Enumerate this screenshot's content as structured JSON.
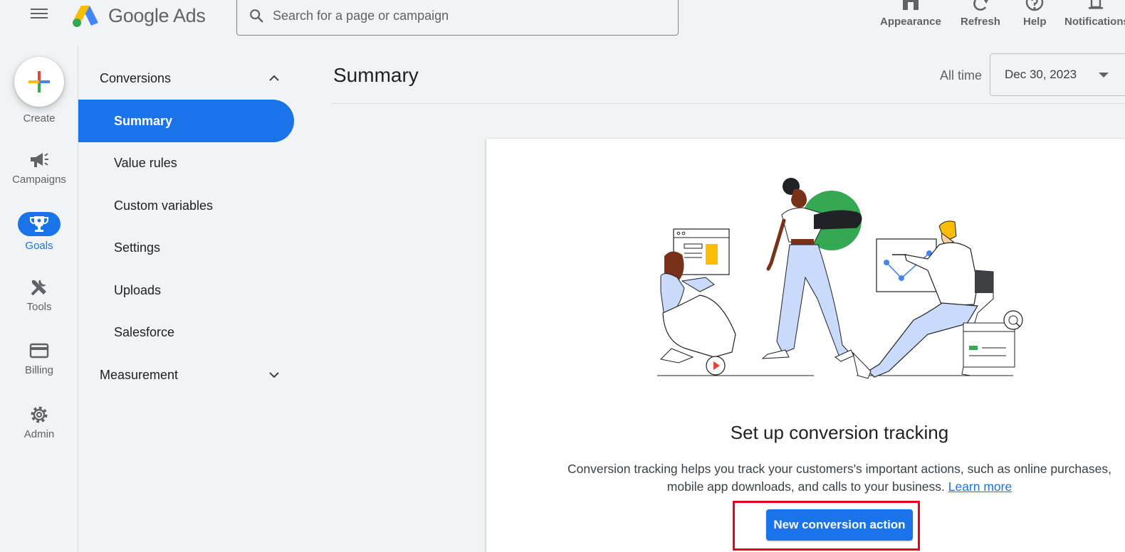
{
  "header": {
    "menu_icon": "hamburger-menu-icon",
    "logo_text": "Google Ads",
    "search_placeholder": "Search for a page or campaign",
    "actions": [
      {
        "label": "Appearance",
        "icon": "appearance-icon"
      },
      {
        "label": "Refresh",
        "icon": "refresh-icon"
      },
      {
        "label": "Help",
        "icon": "help-icon"
      },
      {
        "label": "Notifications",
        "icon": "bell-icon"
      }
    ]
  },
  "rail": {
    "create_label": "Create",
    "items": [
      {
        "label": "Campaigns",
        "icon": "megaphone-icon"
      },
      {
        "label": "Goals",
        "icon": "trophy-icon",
        "active": true
      },
      {
        "label": "Tools",
        "icon": "tools-icon"
      },
      {
        "label": "Billing",
        "icon": "credit-card-icon"
      },
      {
        "label": "Admin",
        "icon": "gear-icon"
      }
    ]
  },
  "nav": {
    "groups": [
      {
        "label": "Conversions",
        "expanded": true
      },
      {
        "label": "Measurement",
        "expanded": false
      }
    ],
    "items": [
      "Summary",
      "Value rules",
      "Custom variables",
      "Settings",
      "Uploads",
      "Salesforce"
    ],
    "active_item": "Summary"
  },
  "main": {
    "title": "Summary",
    "date_range_label": "All time",
    "date_value": "Dec 30, 2023"
  },
  "card": {
    "title": "Set up conversion tracking",
    "description_line1": "Conversion tracking helps you track your customers's important actions, such as online purchases,",
    "description_line2": "mobile app downloads, and calls to your business.",
    "learn_more": "Learn more",
    "primary_button": "New conversion action"
  },
  "colors": {
    "accent": "#1a73e8",
    "background": "#f1f3f4",
    "highlight": "#e8001c"
  }
}
